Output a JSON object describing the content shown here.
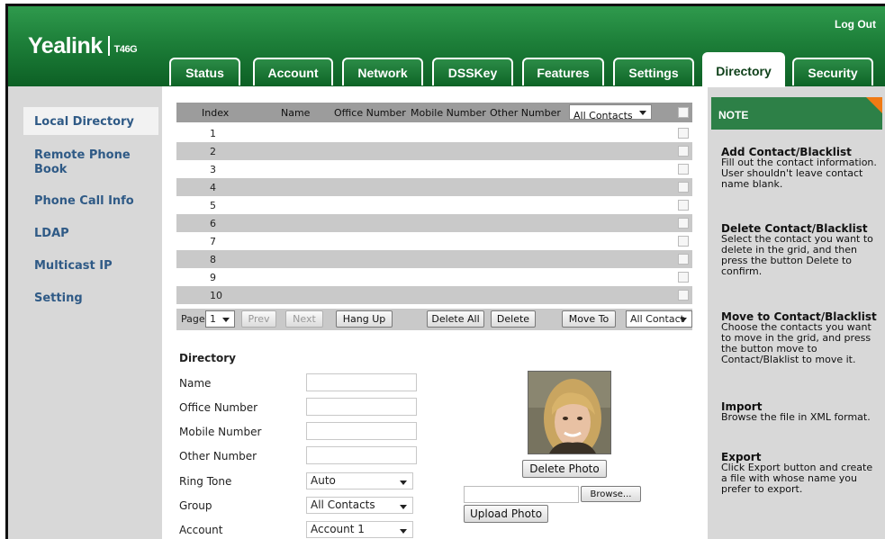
{
  "header": {
    "brand": "Yealink",
    "model": "T46G",
    "logout": "Log Out",
    "tabs": [
      "Status",
      "Account",
      "Network",
      "DSSKey",
      "Features",
      "Settings",
      "Directory",
      "Security"
    ],
    "active_tab": "Directory"
  },
  "sidebar": {
    "items": [
      "Local Directory",
      "Remote Phone Book",
      "Phone Call Info",
      "LDAP",
      "Multicast IP",
      "Setting"
    ],
    "active": "Local Directory"
  },
  "grid": {
    "columns": [
      "Index",
      "Name",
      "Office Number",
      "Mobile Number",
      "Other Number"
    ],
    "filter": "All Contacts",
    "rows": [
      "1",
      "2",
      "3",
      "4",
      "5",
      "6",
      "7",
      "8",
      "9",
      "10"
    ]
  },
  "pager": {
    "page_label": "Page",
    "page_value": "1",
    "prev": "Prev",
    "next": "Next",
    "hang_up": "Hang Up",
    "delete_all": "Delete All",
    "delete": "Delete",
    "move_to": "Move To",
    "move_target": "All Contact"
  },
  "form": {
    "title": "Directory",
    "name_label": "Name",
    "office_label": "Office Number",
    "mobile_label": "Mobile Number",
    "other_label": "Other Number",
    "ringtone_label": "Ring Tone",
    "ringtone_value": "Auto",
    "group_label": "Group",
    "group_value": "All Contacts",
    "account_label": "Account",
    "account_value": "Account 1",
    "delete_photo": "Delete Photo",
    "browse": "Browse...",
    "upload_photo": "Upload Photo"
  },
  "notes": {
    "title": "NOTE",
    "blocks": [
      {
        "title": "Add Contact/Blacklist",
        "text": "Fill out the contact information. User shouldn't leave contact name blank."
      },
      {
        "title": "Delete Contact/Blacklist",
        "text": "Select the contact you want to delete in the grid, and then press the button Delete to confirm."
      },
      {
        "title": "Move to Contact/Blacklist",
        "text": "Choose the contacts you want to move in the grid, and press the button move to Contact/Blaklist to move it."
      },
      {
        "title": "Import",
        "text": "Browse the file in XML format."
      },
      {
        "title": "Export",
        "text": "Click Export button and create a file with whose name you prefer to export."
      }
    ]
  },
  "colors": {
    "header_green": "#1d7f39",
    "note_green": "#2d8047",
    "note_corner": "#f07a14",
    "sidebar_link": "#2f5a86",
    "panel_gray": "#d8d8d8"
  }
}
